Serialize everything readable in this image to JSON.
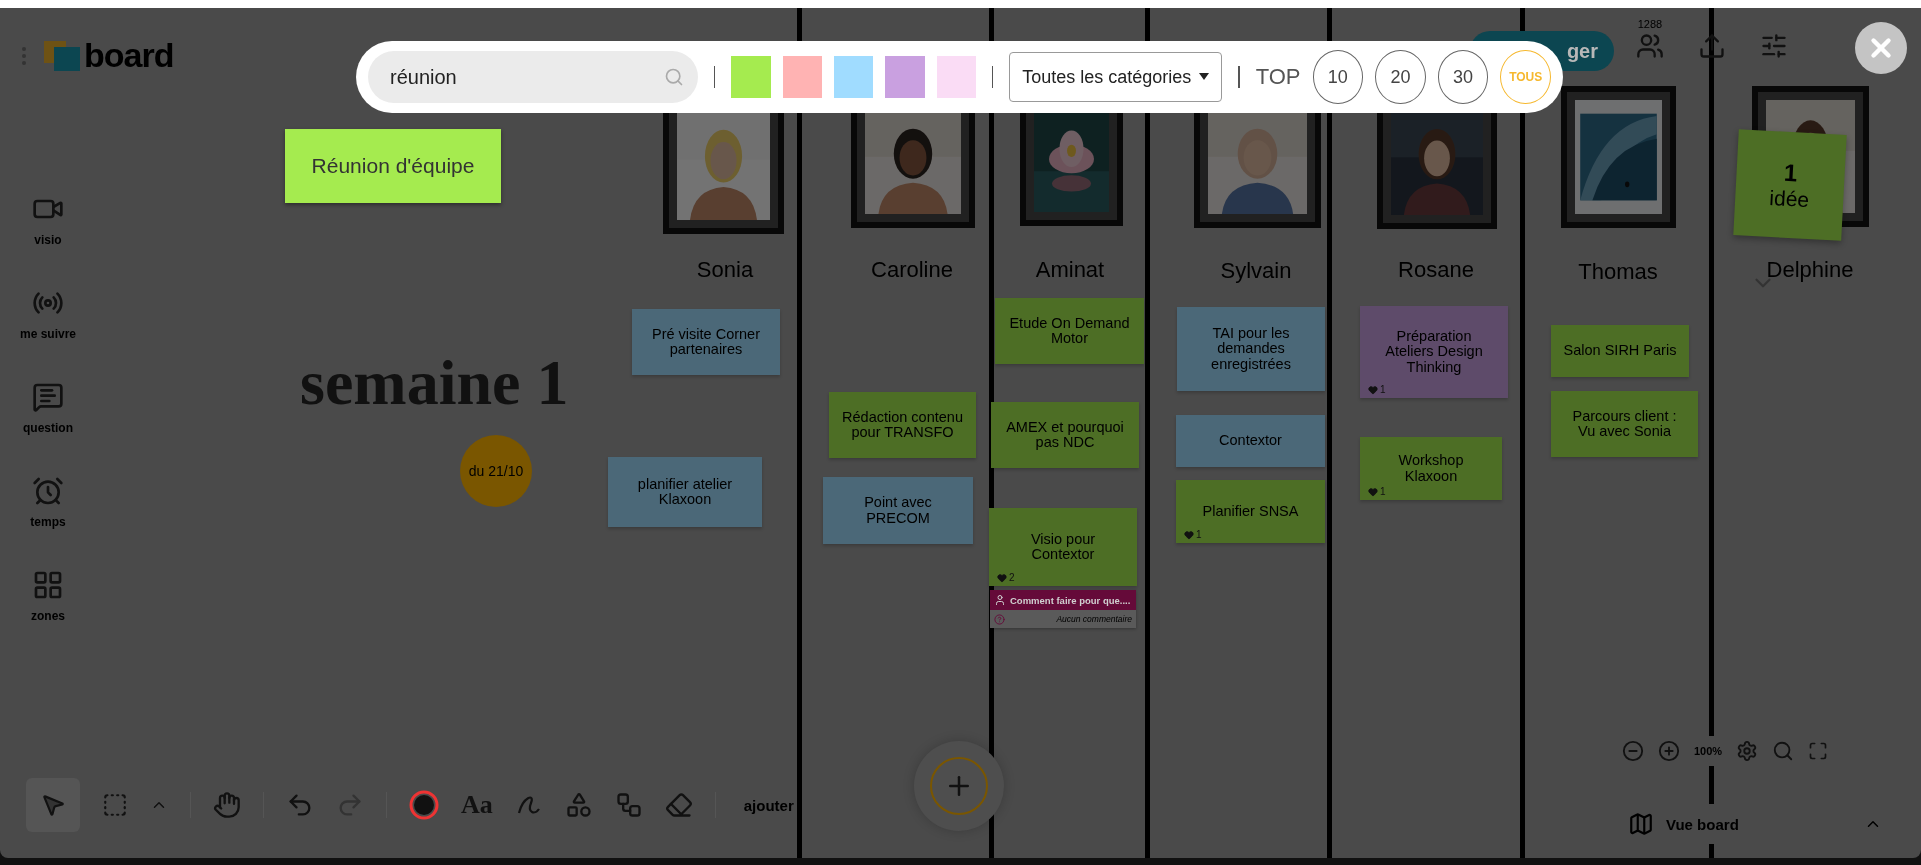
{
  "topbar": {
    "logo": "board",
    "share_button": "ger",
    "participants_count": "1288"
  },
  "sidebar": [
    {
      "label": "visio"
    },
    {
      "label": "me suivre"
    },
    {
      "label": "question"
    },
    {
      "label": "temps"
    },
    {
      "label": "zones"
    }
  ],
  "board": {
    "title": "semaine 1",
    "date_badge": "du 21/10",
    "columns": [
      {
        "name": "Sonia"
      },
      {
        "name": "Caroline"
      },
      {
        "name": "Aminat"
      },
      {
        "name": "Sylvain"
      },
      {
        "name": "Rosane"
      },
      {
        "name": "Thomas"
      },
      {
        "name": "Delphine"
      }
    ],
    "notes": [
      {
        "text": "Pré visite Corner partenaires",
        "color": "#4b6878"
      },
      {
        "text": "planifier atelier Klaxoon",
        "color": "#4b6878"
      },
      {
        "text": "Rédaction contenu pour TRANSFO",
        "color": "#4d6e25"
      },
      {
        "text": "Point avec PRECOM",
        "color": "#4b6878"
      },
      {
        "text": "Etude On Demand Motor",
        "color": "#4d6e25"
      },
      {
        "text": "AMEX et pourquoi pas NDC",
        "color": "#4d6e25"
      },
      {
        "text": "Visio pour Contextor",
        "color": "#4d6e25",
        "likes": "2"
      },
      {
        "text": "TAI pour les demandes enregistrées",
        "color": "#4b6878"
      },
      {
        "text": "Contextor",
        "color": "#4b6878"
      },
      {
        "text": "Planifier SNSA",
        "color": "#4d6e25",
        "likes": "1"
      },
      {
        "text": "Préparation Ateliers Design Thinking",
        "color": "#5e4b6a",
        "likes": "1"
      },
      {
        "text": "Workshop Klaxoon",
        "color": "#4d6e25",
        "likes": "1"
      },
      {
        "text": "Salon SIRH Paris",
        "color": "#4d6e25"
      },
      {
        "text": "Parcours client : Vu avec Sonia",
        "color": "#4d6e25"
      }
    ],
    "comment": {
      "title": "Comment faire pour que....",
      "status": "Aucun commentaire"
    },
    "idea_counter": {
      "count": "1",
      "label": "idée"
    }
  },
  "bottom_toolbar": {
    "text_tool": "Aa",
    "add_label": "ajouter",
    "zoom": "100%",
    "view_label": "Vue board"
  },
  "search_overlay": {
    "query": "réunion",
    "colors": [
      {
        "color": "#a5eb4f"
      },
      {
        "color": "#ffb3b3"
      },
      {
        "color": "#a0dcff"
      },
      {
        "color": "#c9a0e0"
      },
      {
        "color": "#fadcf5"
      }
    ],
    "category": "Toutes les catégories",
    "top_label": "TOP",
    "top_options": [
      {
        "label": "10",
        "selected": false
      },
      {
        "label": "20",
        "selected": false
      },
      {
        "label": "30",
        "selected": false
      },
      {
        "label": "TOUS",
        "selected": true
      }
    ]
  },
  "highlighted_note": {
    "text": "Réunion d'équipe"
  }
}
